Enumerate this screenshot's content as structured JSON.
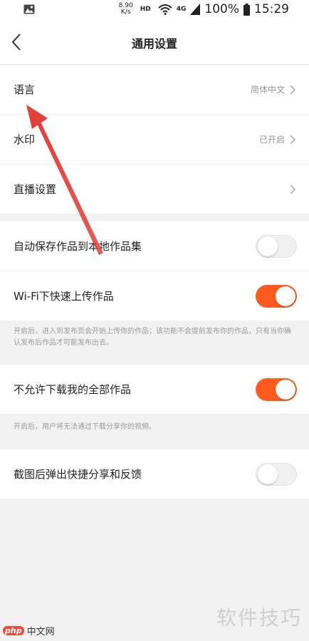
{
  "status_bar": {
    "net_speed_value": "8.90",
    "net_speed_unit": "K/s",
    "hd": "HD",
    "network": "4G",
    "battery": "100%",
    "time": "15:29"
  },
  "header": {
    "title": "通用设置"
  },
  "group1": [
    {
      "label": "语言",
      "value": "简体中文"
    },
    {
      "label": "水印",
      "value": "已开启"
    },
    {
      "label": "直播设置",
      "value": ""
    }
  ],
  "toggles": {
    "auto_save": {
      "label": "自动保存作品到本地作品集",
      "on": false
    },
    "wifi_upload": {
      "label": "Wi-Fi下快速上传作品",
      "on": true
    },
    "no_download": {
      "label": "不允许下载我的全部作品",
      "on": true
    },
    "screenshot": {
      "label": "截图后弹出快捷分享和反馈",
      "on": false
    }
  },
  "notes": {
    "wifi_note": "开启后，进入到发布页会开始上传你的作品；该功能不会提前发布你的作品，只有当你确认发布后作品才可能发布出去。",
    "download_note": "开启后，用户将无法通过下载分享你的视频。"
  },
  "watermark": {
    "text": "软件技巧",
    "site_badge": "php",
    "site_name": "中文网"
  },
  "colors": {
    "accent": "#ff5a1f",
    "annotation_arrow": "#e0413b"
  }
}
